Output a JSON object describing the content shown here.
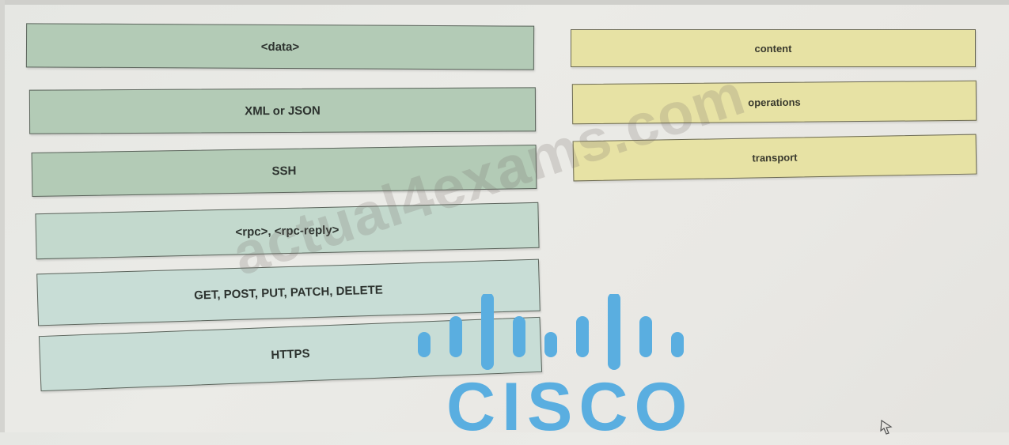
{
  "drag_items": [
    {
      "label": "<data>"
    },
    {
      "label": "XML or JSON"
    },
    {
      "label": "SSH"
    },
    {
      "label": "<rpc>, <rpc-reply>"
    },
    {
      "label": "GET, POST, PUT, PATCH, DELETE"
    },
    {
      "label": "HTTPS"
    }
  ],
  "drop_targets": [
    {
      "label": "content"
    },
    {
      "label": "operations"
    },
    {
      "label": "transport"
    }
  ],
  "watermark": "actual4exams.com",
  "logo": {
    "word": "CISCO",
    "color": "#5aaee0"
  },
  "colors": {
    "drag_item_fill": "#b3cbb6",
    "drop_target_fill": "#e7e2a4"
  }
}
